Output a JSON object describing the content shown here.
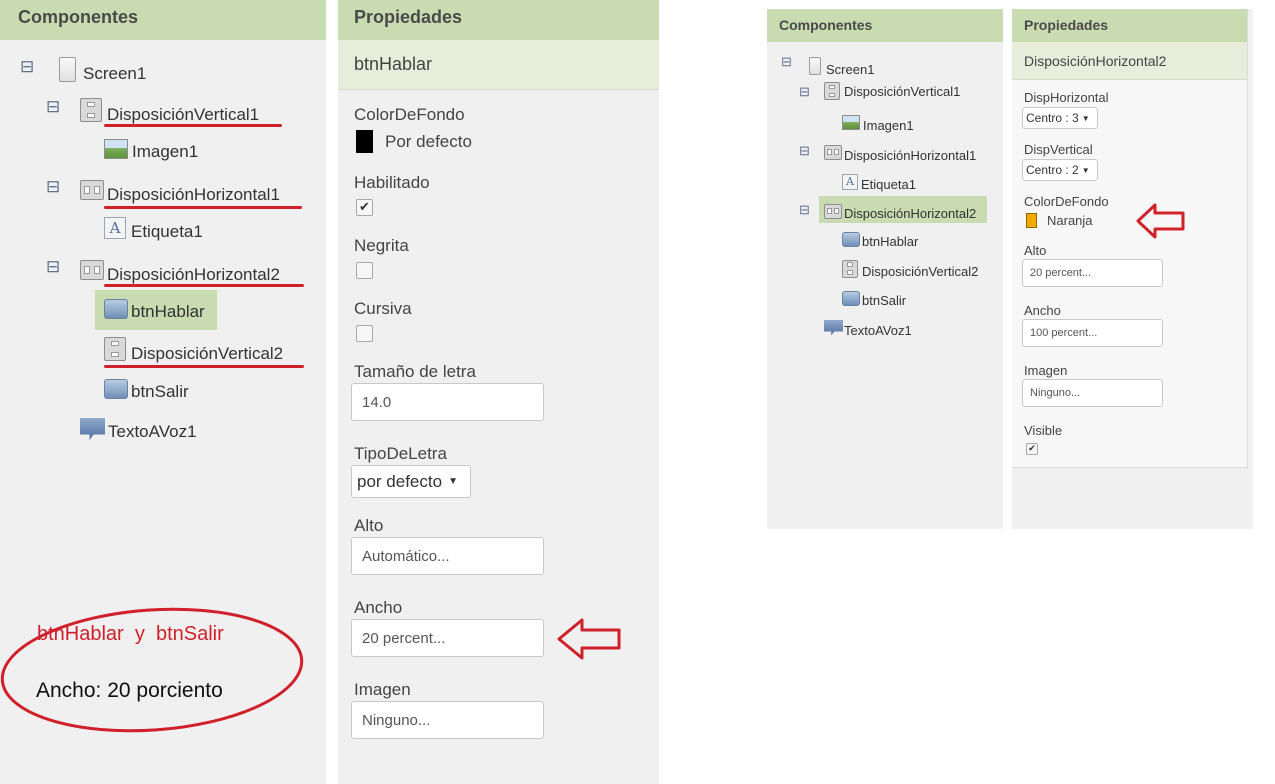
{
  "left": {
    "components_title": "Componentes",
    "properties_title": "Propiedades",
    "selected_component": "btnHablar",
    "tree": [
      {
        "label": "Screen1",
        "icon": "screen-icon",
        "toggle": "⊟"
      },
      {
        "label": "DisposiciónVertical1",
        "icon": "vertical-arrangement-icon",
        "toggle": "⊟"
      },
      {
        "label": "Imagen1",
        "icon": "image-icon"
      },
      {
        "label": "DisposiciónHorizontal1",
        "icon": "horizontal-arrangement-icon",
        "toggle": "⊟"
      },
      {
        "label": "Etiqueta1",
        "icon": "label-icon"
      },
      {
        "label": "DisposiciónHorizontal2",
        "icon": "horizontal-arrangement-icon",
        "toggle": "⊟"
      },
      {
        "label": "btnHablar",
        "icon": "button-icon"
      },
      {
        "label": "DisposiciónVertical2",
        "icon": "vertical-arrangement-icon"
      },
      {
        "label": "btnSalir",
        "icon": "button-icon"
      },
      {
        "label": "TextoAVoz1",
        "icon": "text-to-speech-icon"
      }
    ],
    "props": {
      "colordefondo_label": "ColorDeFondo",
      "colordefondo_value": "Por defecto",
      "colordefondo_color": "#000000",
      "habilitado_label": "Habilitado",
      "habilitado_checked": true,
      "negrita_label": "Negrita",
      "negrita_checked": false,
      "cursiva_label": "Cursiva",
      "cursiva_checked": false,
      "tamano_label": "Tamaño de letra",
      "tamano_value": "14.0",
      "tipo_label": "TipoDeLetra",
      "tipo_value": "por defecto",
      "alto_label": "Alto",
      "alto_value": "Automático...",
      "ancho_label": "Ancho",
      "ancho_value": "20 percent...",
      "imagen_label": "Imagen",
      "imagen_value": "Ninguno..."
    },
    "annotation_line1": "btnHablar  y  btnSalir",
    "annotation_line2": "Ancho: 20 porciento"
  },
  "right": {
    "components_title": "Componentes",
    "properties_title": "Propiedades",
    "selected_component": "DisposiciónHorizontal2",
    "tree": [
      {
        "label": "Screen1",
        "icon": "screen-icon",
        "toggle": "⊟"
      },
      {
        "label": "DisposiciónVertical1",
        "icon": "vertical-arrangement-icon",
        "toggle": "⊟"
      },
      {
        "label": "Imagen1",
        "icon": "image-icon"
      },
      {
        "label": "DisposiciónHorizontal1",
        "icon": "horizontal-arrangement-icon",
        "toggle": "⊟"
      },
      {
        "label": "Etiqueta1",
        "icon": "label-icon"
      },
      {
        "label": "DisposiciónHorizontal2",
        "icon": "horizontal-arrangement-icon",
        "toggle": "⊟"
      },
      {
        "label": "btnHablar",
        "icon": "button-icon"
      },
      {
        "label": "DisposiciónVertical2",
        "icon": "vertical-arrangement-icon"
      },
      {
        "label": "btnSalir",
        "icon": "button-icon"
      },
      {
        "label": "TextoAVoz1",
        "icon": "text-to-speech-icon"
      }
    ],
    "props": {
      "disph_label": "DispHorizontal",
      "disph_value": "Centro : 3",
      "dispv_label": "DispVertical",
      "dispv_value": "Centro : 2",
      "colordefondo_label": "ColorDeFondo",
      "colordefondo_value": "Naranja",
      "colordefondo_color": "#f5a900",
      "alto_label": "Alto",
      "alto_value": "20 percent...",
      "ancho_label": "Ancho",
      "ancho_value": "100 percent...",
      "imagen_label": "Imagen",
      "imagen_value": "Ninguno...",
      "visible_label": "Visible",
      "visible_checked": true
    }
  },
  "colors": {
    "header_green": "#c9dbb1",
    "annotation_red": "#d0202a",
    "panel_gray": "#f0f0f0"
  }
}
